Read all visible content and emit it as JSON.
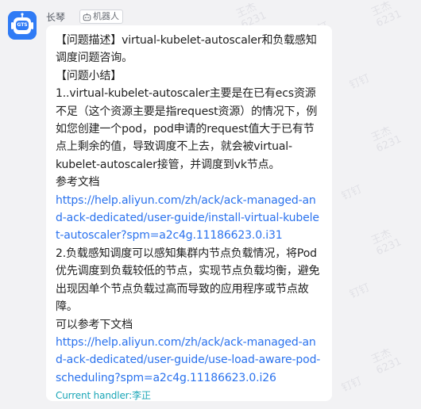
{
  "sender": {
    "name": "长琴",
    "badge": "机器人",
    "avatar_text": "GTS"
  },
  "watermark": {
    "name": "王杰",
    "id": "6231",
    "app": "钉钉"
  },
  "message": {
    "heading_desc": "【问题描述】virtual-kubelet-autoscaler和负载感知调度问题咨询。",
    "heading_summary": "【问题小结】",
    "point1": "1..virtual-kubelet-autoscaler主要是在已有ecs资源不足（这个资源主要是指request资源）的情况下，例如您创建一个pod，pod申请的request值大于已有节点上剩余的值，导致调度不上去，就会被virtual-kubelet-autoscaler接管，并调度到vk节点。",
    "ref1_label": "参考文档",
    "ref1_url": "https://help.aliyun.com/zh/ack/ack-managed-and-ack-dedicated/user-guide/install-virtual-kubelet-autoscaler?spm=a2c4g.11186623.0.i31",
    "point2": "2.负载感知调度可以感知集群内节点负载情况，将Pod优先调度到负载较低的节点，实现节点负载均衡，避免出现因单个节点负载过高而导致的应用程序或节点故障。",
    "ref2_label": "可以参考下文档",
    "ref2_url": "https://help.aliyun.com/zh/ack/ack-managed-and-ack-dedicated/user-guide/use-load-aware-pod-scheduling?spm=a2c4g.11186623.0.i26",
    "handler": "Current handler:李正"
  },
  "colors": {
    "background": "#f2f2f4",
    "bubble": "#ffffff",
    "link": "#2a72ee",
    "handler": "#1aa6b7",
    "avatar": "#2f7bf5"
  }
}
